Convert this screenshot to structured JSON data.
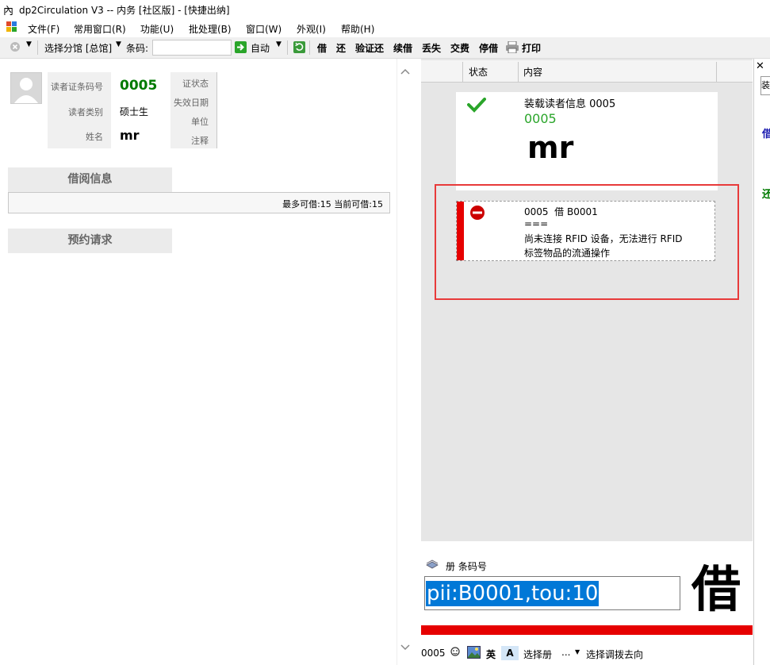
{
  "window": {
    "title": "dp2Circulation V3 -- 内务 [社区版] - [快捷出纳]"
  },
  "menu": [
    "文件(F)",
    "常用窗口(R)",
    "功能(U)",
    "批处理(B)",
    "窗口(W)",
    "外观(I)",
    "帮助(H)"
  ],
  "toolbar": {
    "branch_label": "选择分馆 [总馆]",
    "barcode_label": "条码:",
    "auto_label": "自动",
    "actions": [
      "借",
      "还",
      "验证还",
      "续借",
      "丢失",
      "交费",
      "停借"
    ],
    "print_label": "打印"
  },
  "reader": {
    "barcode_label": "读者证条码号",
    "barcode_value": "0005",
    "type_label": "读者类别",
    "type_value": "硕士生",
    "name_label": "姓名",
    "name_value": "mr",
    "status_label": "证状态",
    "expire_label": "失效日期",
    "unit_label": "单位",
    "note_label": "注释"
  },
  "borrow": {
    "title": "借阅信息",
    "summary": "最多可借:15 当前可借:15"
  },
  "reservation": {
    "title": "预约请求"
  },
  "list": {
    "col_status": "状态",
    "col_content": "内容",
    "entries": [
      {
        "title": "装载读者信息 0005",
        "barcode": "0005",
        "name": "mr",
        "status": "success"
      },
      {
        "line1": "0005  借 B0001",
        "line2": "===",
        "line3": "尚未连接 RFID 设备，无法进行 RFID",
        "line4": "标签物品的流通操作",
        "status": "error"
      }
    ]
  },
  "input": {
    "label": "册 条码号",
    "value": "pii:B0001,tou:10",
    "mode_char": "借"
  },
  "statusbar": {
    "reader": "0005",
    "ime": "英",
    "ime2": "A",
    "select_item": "选择册",
    "ellipsis": "...",
    "select_direction": "选择调拨去向"
  },
  "far_right": {
    "tab": "装",
    "text1": "借",
    "text2": "还"
  },
  "colors": {
    "success": "#2aa52a",
    "error": "#cc0000",
    "reader_number": "#007a00",
    "highlight_border": "#e83a3a",
    "selection": "#0078d7"
  }
}
